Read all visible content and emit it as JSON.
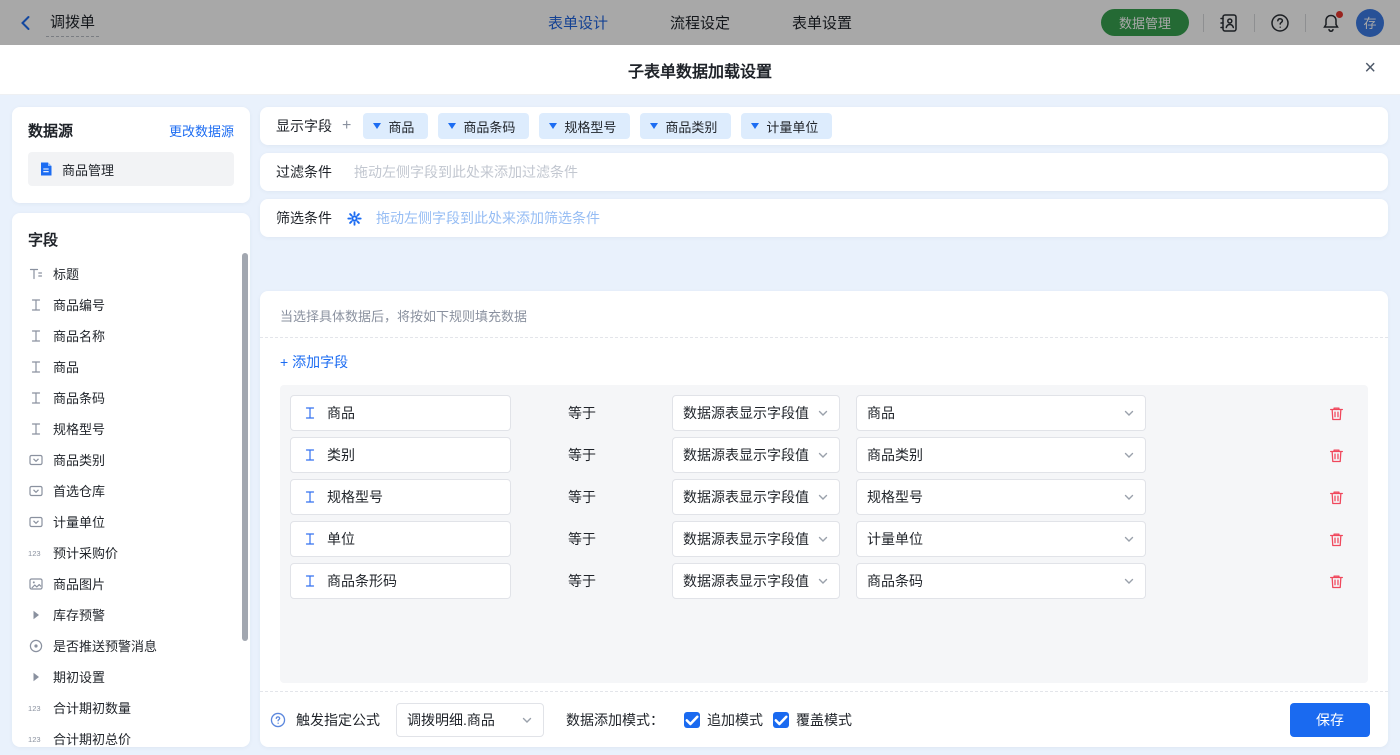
{
  "topbar": {
    "back_label": "调拨单",
    "tabs": [
      {
        "label": "表单设计",
        "active": true
      },
      {
        "label": "流程设定",
        "active": false
      },
      {
        "label": "表单设置",
        "active": false
      }
    ],
    "data_manage_button": "数据管理",
    "avatar_text": "存"
  },
  "modal": {
    "title": "子表单数据加载设置",
    "close_glyph": "×",
    "datasource": {
      "header": "数据源",
      "change_link": "更改数据源",
      "selected": "商品管理"
    },
    "fields_panel": {
      "header": "字段",
      "items": [
        {
          "icon": "title",
          "label": "标题"
        },
        {
          "icon": "text",
          "label": "商品编号"
        },
        {
          "icon": "text",
          "label": "商品名称"
        },
        {
          "icon": "text",
          "label": "商品"
        },
        {
          "icon": "text",
          "label": "商品条码"
        },
        {
          "icon": "text",
          "label": "规格型号"
        },
        {
          "icon": "select",
          "label": "商品类别"
        },
        {
          "icon": "select",
          "label": "首选仓库"
        },
        {
          "icon": "select",
          "label": "计量单位"
        },
        {
          "icon": "number",
          "label": "预计采购价"
        },
        {
          "icon": "image",
          "label": "商品图片"
        },
        {
          "icon": "group",
          "label": "库存预警"
        },
        {
          "icon": "radio",
          "label": "是否推送预警消息"
        },
        {
          "icon": "group",
          "label": "期初设置"
        },
        {
          "icon": "number",
          "label": "合计期初数量"
        },
        {
          "icon": "number",
          "label": "合计期初总价"
        }
      ]
    },
    "display_fields": {
      "label": "显示字段",
      "add_glyph": "+",
      "chips": [
        "商品",
        "商品条码",
        "规格型号",
        "商品类别",
        "计量单位"
      ]
    },
    "filter": {
      "label": "过滤条件",
      "placeholder": "拖动左侧字段到此处来添加过滤条件"
    },
    "screen": {
      "label": "筛选条件",
      "placeholder": "拖动左侧字段到此处来添加筛选条件"
    },
    "rules": {
      "hint": "当选择具体数据后，将按如下规则填充数据",
      "add_field_label": "添加字段",
      "add_field_glyph": "+",
      "equals_label": "等于",
      "rows": [
        {
          "target": "商品",
          "source_type": "数据源表显示字段值",
          "source_field": "商品"
        },
        {
          "target": "类别",
          "source_type": "数据源表显示字段值",
          "source_field": "商品类别"
        },
        {
          "target": "规格型号",
          "source_type": "数据源表显示字段值",
          "source_field": "规格型号"
        },
        {
          "target": "单位",
          "source_type": "数据源表显示字段值",
          "source_field": "计量单位"
        },
        {
          "target": "商品条形码",
          "source_type": "数据源表显示字段值",
          "source_field": "商品条码"
        }
      ]
    },
    "footer": {
      "trigger_label": "触发指定公式",
      "trigger_value": "调拨明细.商品",
      "mode_label": "数据添加模式：",
      "checkboxes": [
        {
          "label": "追加模式",
          "checked": true
        },
        {
          "label": "覆盖模式",
          "checked": true
        }
      ],
      "save_label": "保存"
    }
  },
  "colors": {
    "accent_blue": "#1c6cf2",
    "primary_button": "#1a6af0",
    "chip_bg": "#ddecfd",
    "green_button": "#37a24f",
    "danger_red": "#f0475c",
    "page_bg": "#e9f1fc",
    "panel_gray": "#f5f6f8",
    "notification_dot": "#e8372f"
  }
}
